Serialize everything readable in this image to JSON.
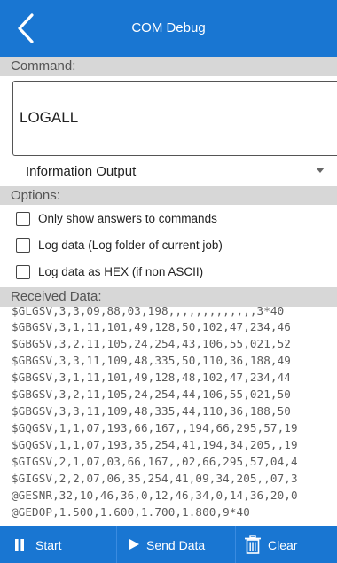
{
  "header": {
    "title": "COM Debug"
  },
  "command": {
    "label": "Command:",
    "value": "LOGALL"
  },
  "output_select": {
    "value": "Information Output"
  },
  "options": {
    "label": "Options:",
    "items": [
      {
        "label": "Only show answers to commands",
        "checked": false
      },
      {
        "label": "Log data (Log folder of current job)",
        "checked": false
      },
      {
        "label": "Log data as HEX (if non ASCII)",
        "checked": false
      }
    ]
  },
  "received": {
    "label": "Received Data:",
    "lines": [
      "$GLGSV,3,3,09,88,03,198,,,,,,,,,,,,,3*40",
      "$GBGSV,3,1,11,101,49,128,50,102,47,234,46",
      "$GBGSV,3,2,11,105,24,254,43,106,55,021,52",
      "$GBGSV,3,3,11,109,48,335,50,110,36,188,49",
      "$GBGSV,3,1,11,101,49,128,48,102,47,234,44",
      "$GBGSV,3,2,11,105,24,254,44,106,55,021,50",
      "$GBGSV,3,3,11,109,48,335,44,110,36,188,50",
      "$GQGSV,1,1,07,193,66,167,,194,66,295,57,19",
      "$GQGSV,1,1,07,193,35,254,41,194,34,205,,19",
      "$GIGSV,2,1,07,03,66,167,,02,66,295,57,04,4",
      "$GIGSV,2,2,07,06,35,254,41,09,34,205,,07,3",
      "@GESNR,32,10,46,36,0,12,46,34,0,14,36,20,0",
      "@GEDOP,1.500,1.600,1.700,1.800,9*40"
    ]
  },
  "footer": {
    "start_label": "Start",
    "send_label": "Send Data",
    "clear_label": "Clear"
  },
  "colors": {
    "accent": "#1976d2",
    "section_bg": "#d7d7d7"
  },
  "icons": [
    "back-arrow-icon",
    "dropdown-arrow-icon",
    "pause-icon",
    "play-icon",
    "trash-icon"
  ]
}
